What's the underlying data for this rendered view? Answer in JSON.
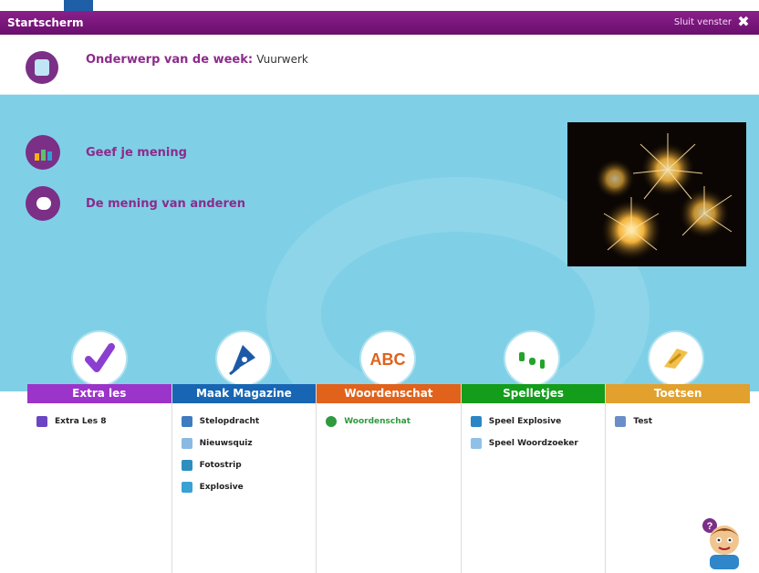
{
  "window": {
    "title": "Startscherm",
    "close_label": "Sluit venster",
    "close_glyph": "✖"
  },
  "topic": {
    "label": "Onderwerp van de week:",
    "value": "Vuurwerk"
  },
  "options": [
    {
      "label": "Geef je mening",
      "icon": "bar-chart-icon"
    },
    {
      "label": "De mening van anderen",
      "icon": "speech-bubble-icon"
    }
  ],
  "categories": [
    {
      "title": "Extra les",
      "color": "#9b34c9",
      "icon": "checkmark-icon",
      "items": [
        {
          "label": "Extra Les 8",
          "icon": "check-icon",
          "color": "#6a45c4"
        }
      ]
    },
    {
      "title": "Maak Magazine",
      "color": "#1865b3",
      "icon": "pen-nib-icon",
      "items": [
        {
          "label": "Stelopdracht",
          "icon": "pen-icon",
          "color": "#3e7cc1"
        },
        {
          "label": "Nieuwsquiz",
          "icon": "question-icon",
          "color": "#8ab9e4"
        },
        {
          "label": "Fotostrip",
          "icon": "camera-icon",
          "color": "#2c8fbf"
        },
        {
          "label": "Explosive",
          "icon": "game-icon",
          "color": "#37a2d3"
        }
      ]
    },
    {
      "title": "Woordenschat",
      "color": "#e0621b",
      "icon": "abc-icon",
      "items": [
        {
          "label": "Woordenschat",
          "icon": "word-icon",
          "color": "#2f9a3d",
          "text_color": "#2f9a3d"
        }
      ]
    },
    {
      "title": "Spelletjes",
      "color": "#149c1b",
      "icon": "dice-icon",
      "items": [
        {
          "label": "Speel Explosive",
          "icon": "game-icon",
          "color": "#2b86c6"
        },
        {
          "label": "Speel Woordzoeker",
          "icon": "search-game-icon",
          "color": "#8fc1e8"
        }
      ]
    },
    {
      "title": "Toetsen",
      "color": "#e2a02c",
      "icon": "test-icon",
      "items": [
        {
          "label": "Test",
          "icon": "list-icon",
          "color": "#6a8fc8"
        }
      ]
    }
  ]
}
